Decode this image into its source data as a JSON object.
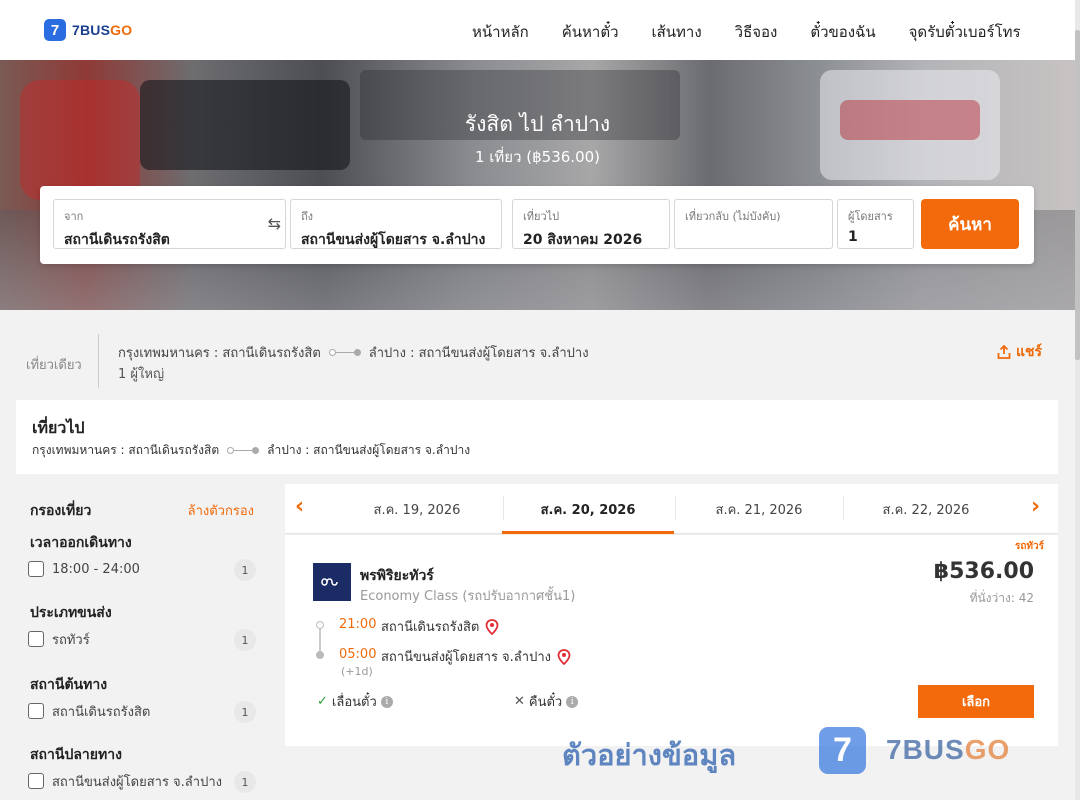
{
  "header": {
    "logo_badge": "7",
    "logo_brand": "7BUS",
    "logo_brand_accent": "GO",
    "nav": [
      "หน้าหลัก",
      "ค้นหาตั๋ว",
      "เส้นทาง",
      "วิธีจอง",
      "ตั๋วของฉัน",
      "จุดรับตั๋วเบอร์โทร"
    ]
  },
  "hero": {
    "title": "รังสิต ไป ลำปาง",
    "subtitle": "1 เที่ยว (฿536.00)"
  },
  "search": {
    "from_label": "จาก",
    "from_value": "สถานีเดินรถรังสิต",
    "to_label": "ถึง",
    "to_value": "สถานีขนส่งผู้โดยสาร จ.ลำปาง",
    "depart_label": "เที่ยวไป",
    "depart_value": "20 สิงหาคม 2026",
    "return_label": "เที่ยวกลับ (ไม่บังคับ)",
    "return_value": "",
    "pax_label": "ผู้โดยสาร",
    "pax_value": "1",
    "button": "ค้นหา"
  },
  "summary": {
    "trip_type": "เที่ยวเดียว",
    "origin": "กรุงเทพมหานคร : สถานีเดินรถรังสิต",
    "destination": "ลำปาง : สถานีขนส่งผู้โดยสาร จ.ลำปาง",
    "passengers": "1 ผู้ใหญ่",
    "share": "แชร์"
  },
  "outbound": {
    "title": "เที่ยวไป",
    "origin": "กรุงเทพมหานคร : สถานีเดินรถรังสิต",
    "destination": "ลำปาง : สถานีขนส่งผู้โดยสาร จ.ลำปาง"
  },
  "filter": {
    "title": "กรองเที่ยว",
    "clear": "ล้างตัวกรอง",
    "groups": [
      {
        "title": "เวลาออกเดินทาง",
        "option": "18:00 - 24:00",
        "count": "1"
      },
      {
        "title": "ประเภทขนส่ง",
        "option": "รถทัวร์",
        "count": "1"
      },
      {
        "title": "สถานีต้นทาง",
        "option": "สถานีเดินรถรังสิต",
        "count": "1"
      },
      {
        "title": "สถานีปลายทาง",
        "option": "สถานีขนส่งผู้โดยสาร จ.ลำปาง",
        "count": "1"
      }
    ]
  },
  "dates": {
    "tabs": [
      "ส.ค. 19, 2026",
      "ส.ค. 20, 2026",
      "ส.ค. 21, 2026",
      "ส.ค. 22, 2026"
    ],
    "active_index": 1
  },
  "result": {
    "tag": "รถทัวร์",
    "operator": "พรพิริยะทัวร์",
    "class": "Economy Class (รถปรับอากาศชั้น1)",
    "price": "฿536.00",
    "seats": "ที่นั่งว่าง: 42",
    "depart_time": "21:00",
    "depart_station": "สถานีเดินรถรังสิต",
    "arrive_time": "05:00",
    "arrive_station": "สถานีขนส่งผู้โดยสาร จ.ลำปาง",
    "next_day": "(+1d)",
    "reschedule": "เลื่อนตั๋ว",
    "refund": "คืนตั๋ว",
    "select": "เลือก"
  },
  "watermark": {
    "text": "ตัวอย่างข้อมูล",
    "badge": "7",
    "brand": "7BUS",
    "brand_accent": "GO"
  },
  "colors": {
    "accent": "#f26a0c",
    "brand_blue": "#2a6de0"
  }
}
